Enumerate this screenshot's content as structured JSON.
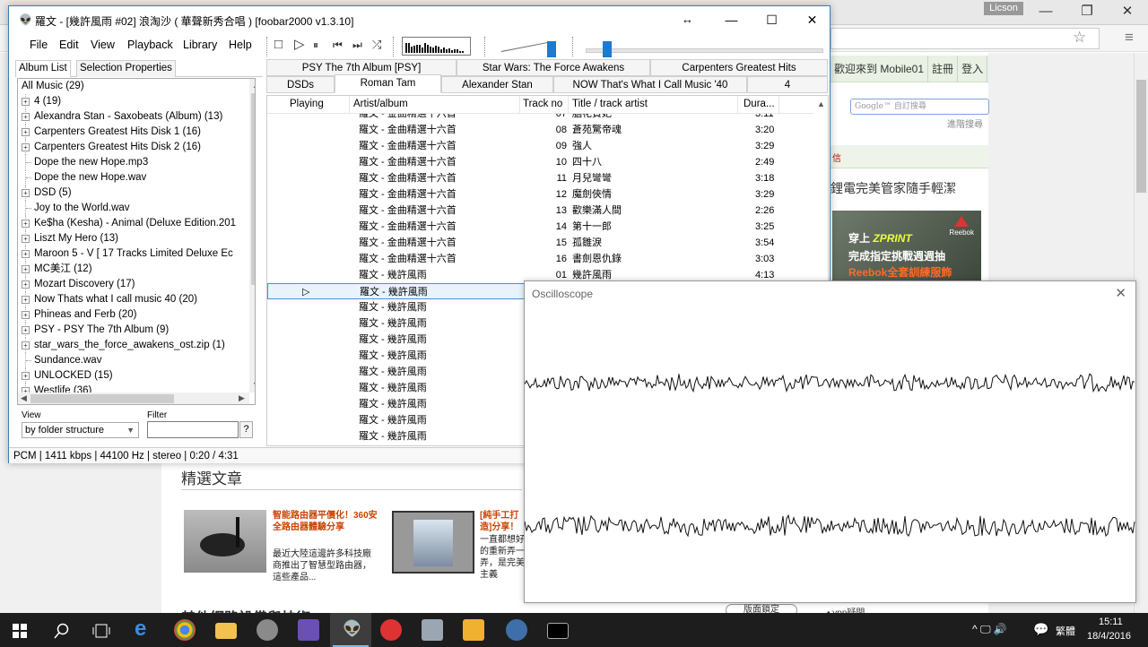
{
  "browser": {
    "user": "Licson",
    "min": "—",
    "restore": "❐",
    "close": "✕",
    "star_icon": "☆",
    "menu_icon": "≡",
    "site_links": [
      "歡迎來到 Mobile01",
      "註冊",
      "登入"
    ],
    "google_search_placeholder": "Google™ 自訂搜尋",
    "advanced_search": "進階搜尋",
    "section_mark": "信",
    "ad_title": "鋰電完美管家隨手輕潔",
    "ad_line1": "穿上",
    "ad_line1_brand": "ZPRINT",
    "ad_line2": "完成指定挑戰週週抽",
    "ad_line3": "Reebok全套訓練服飾",
    "ad_logo": "Reebok",
    "featured_title": "精選文章",
    "articles": [
      {
        "head": "智能路由器平價化！360安全路由器體驗分享",
        "body": "最近大陸這邊許多科技廠商推出了智慧型路由器，這些產品..."
      },
      {
        "head": "[純手工打造]分享！",
        "body": "一直都想好的重新弄一弄，是完美主義"
      }
    ],
    "other_heading": "其他網路設備與技術",
    "pill": "版面鎖定",
    "bullet": "• vpn疑問"
  },
  "foobar": {
    "title": "羅文 - [幾許風雨 #02] 浪淘沙 ( 華聲新秀合唱 )  [foobar2000 v1.3.10]",
    "title_icon": "alien-icon",
    "resize_hint": "↔",
    "min": "—",
    "max": "☐",
    "close": "✕",
    "menu": [
      "File",
      "Edit",
      "View",
      "Playback",
      "Library",
      "Help"
    ],
    "toolbar": {
      "stop": "□",
      "play": "▷",
      "pause": "⏸",
      "prev": "⏮",
      "next": "⏭",
      "random": "⤮"
    },
    "volume_level": 0.92,
    "seek_position": 0.07,
    "left_tabs": [
      "Album List",
      "Selection Properties"
    ],
    "tree": [
      {
        "label": "All Music (29)",
        "type": "root"
      },
      {
        "label": "4 (19)",
        "type": "folder"
      },
      {
        "label": "Alexandra Stan - Saxobeats (Album) (13)",
        "type": "folder"
      },
      {
        "label": "Carpenters Greatest Hits Disk 1 (16)",
        "type": "folder"
      },
      {
        "label": "Carpenters Greatest Hits Disk 2 (16)",
        "type": "folder"
      },
      {
        "label": "Dope the new Hope.mp3",
        "type": "file"
      },
      {
        "label": "Dope the new Hope.wav",
        "type": "file"
      },
      {
        "label": "DSD (5)",
        "type": "folder"
      },
      {
        "label": "Joy to the World.wav",
        "type": "file"
      },
      {
        "label": "Ke$ha (Kesha) - Animal (Deluxe Edition.201",
        "type": "folder"
      },
      {
        "label": "Liszt My Hero (13)",
        "type": "folder"
      },
      {
        "label": "Maroon 5 - V [ 17 Tracks Limited Deluxe Ec",
        "type": "folder"
      },
      {
        "label": "MC美江 (12)",
        "type": "folder"
      },
      {
        "label": "Mozart Discovery (17)",
        "type": "folder"
      },
      {
        "label": "Now Thats what I call music 40 (20)",
        "type": "folder"
      },
      {
        "label": "Phineas and Ferb (20)",
        "type": "folder"
      },
      {
        "label": "PSY - PSY The 7th Album (9)",
        "type": "folder"
      },
      {
        "label": "star_wars_the_force_awakens_ost.zip (1)",
        "type": "folder"
      },
      {
        "label": "Sundance.wav",
        "type": "file"
      },
      {
        "label": "UNLOCKED (15)",
        "type": "folder"
      },
      {
        "label": "Westlife (36)",
        "type": "folder"
      }
    ],
    "view_label": "View",
    "filter_label": "Filter",
    "view_value": "by folder structure",
    "filter_help": "?",
    "status": "PCM | 1411 kbps | 44100 Hz | stereo | 0:20 / 4:31",
    "playlist_tabs_row1": [
      "PSY The 7th Album [PSY]",
      "Star Wars: The Force Awakens",
      "Carpenters Greatest Hits"
    ],
    "playlist_tabs_row2": [
      "DSDs",
      "Roman Tam",
      "Alexander Stan",
      "NOW That's What I Call Music '40",
      "4"
    ],
    "active_playlist": "Roman Tam",
    "columns": [
      "Playing",
      "Artist/album",
      "Track no",
      "Title / track artist",
      "Dura..."
    ],
    "rows": [
      {
        "artist": "羅文 - 金曲精選十六首",
        "track": "07",
        "title": "胭花貴妃",
        "dur": "3:11"
      },
      {
        "artist": "羅文 - 金曲精選十六首",
        "track": "08",
        "title": "蒼苑驚帝魂",
        "dur": "3:20"
      },
      {
        "artist": "羅文 - 金曲精選十六首",
        "track": "09",
        "title": "強人",
        "dur": "3:29"
      },
      {
        "artist": "羅文 - 金曲精選十六首",
        "track": "10",
        "title": "四十八",
        "dur": "2:49"
      },
      {
        "artist": "羅文 - 金曲精選十六首",
        "track": "11",
        "title": "月兒彎彎",
        "dur": "3:18"
      },
      {
        "artist": "羅文 - 金曲精選十六首",
        "track": "12",
        "title": "魔劍俠情",
        "dur": "3:29"
      },
      {
        "artist": "羅文 - 金曲精選十六首",
        "track": "13",
        "title": "歡樂滿人間",
        "dur": "2:26"
      },
      {
        "artist": "羅文 - 金曲精選十六首",
        "track": "14",
        "title": "第十一郎",
        "dur": "3:25"
      },
      {
        "artist": "羅文 - 金曲精選十六首",
        "track": "15",
        "title": "孤雛淚",
        "dur": "3:54"
      },
      {
        "artist": "羅文 - 金曲精選十六首",
        "track": "16",
        "title": "書劍恩仇錄",
        "dur": "3:03"
      },
      {
        "artist": "羅文 - 幾許風雨",
        "track": "01",
        "title": "幾許風雨",
        "dur": "4:13"
      },
      {
        "artist": "羅文 - 幾許風雨",
        "track": "",
        "title": "",
        "dur": "",
        "playing": "▷"
      },
      {
        "artist": "羅文 - 幾許風雨",
        "track": "",
        "title": "",
        "dur": ""
      },
      {
        "artist": "羅文 - 幾許風雨",
        "track": "",
        "title": "",
        "dur": ""
      },
      {
        "artist": "羅文 - 幾許風雨",
        "track": "",
        "title": "",
        "dur": ""
      },
      {
        "artist": "羅文 - 幾許風雨",
        "track": "",
        "title": "",
        "dur": ""
      },
      {
        "artist": "羅文 - 幾許風雨",
        "track": "",
        "title": "",
        "dur": ""
      },
      {
        "artist": "羅文 - 幾許風雨",
        "track": "",
        "title": "",
        "dur": ""
      },
      {
        "artist": "羅文 - 幾許風雨",
        "track": "",
        "title": "",
        "dur": ""
      },
      {
        "artist": "羅文 - 幾許風雨",
        "track": "",
        "title": "",
        "dur": ""
      },
      {
        "artist": "羅文 - 幾許風雨",
        "track": "",
        "title": "",
        "dur": ""
      }
    ]
  },
  "oscilloscope": {
    "title": "Oscilloscope",
    "close": "✕"
  },
  "taskbar": {
    "time": "15:11",
    "date": "18/4/2016",
    "lang": "繁體",
    "tray": "^ 🖵 🔊",
    "notify_icon": "💬"
  }
}
